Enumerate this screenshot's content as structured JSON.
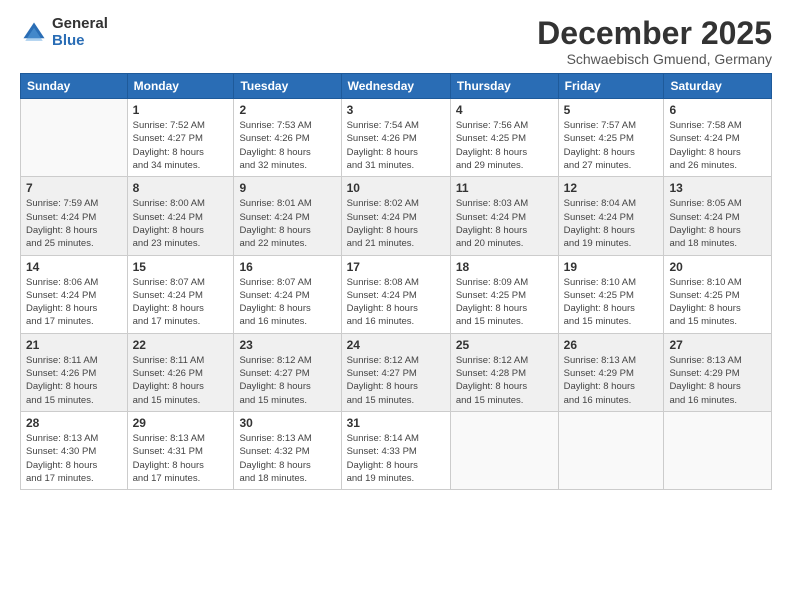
{
  "logo": {
    "general": "General",
    "blue": "Blue"
  },
  "header": {
    "month": "December 2025",
    "location": "Schwaebisch Gmuend, Germany"
  },
  "days_of_week": [
    "Sunday",
    "Monday",
    "Tuesday",
    "Wednesday",
    "Thursday",
    "Friday",
    "Saturday"
  ],
  "weeks": [
    [
      {
        "day": "",
        "info": ""
      },
      {
        "day": "1",
        "info": "Sunrise: 7:52 AM\nSunset: 4:27 PM\nDaylight: 8 hours\nand 34 minutes."
      },
      {
        "day": "2",
        "info": "Sunrise: 7:53 AM\nSunset: 4:26 PM\nDaylight: 8 hours\nand 32 minutes."
      },
      {
        "day": "3",
        "info": "Sunrise: 7:54 AM\nSunset: 4:26 PM\nDaylight: 8 hours\nand 31 minutes."
      },
      {
        "day": "4",
        "info": "Sunrise: 7:56 AM\nSunset: 4:25 PM\nDaylight: 8 hours\nand 29 minutes."
      },
      {
        "day": "5",
        "info": "Sunrise: 7:57 AM\nSunset: 4:25 PM\nDaylight: 8 hours\nand 27 minutes."
      },
      {
        "day": "6",
        "info": "Sunrise: 7:58 AM\nSunset: 4:24 PM\nDaylight: 8 hours\nand 26 minutes."
      }
    ],
    [
      {
        "day": "7",
        "info": "Sunrise: 7:59 AM\nSunset: 4:24 PM\nDaylight: 8 hours\nand 25 minutes."
      },
      {
        "day": "8",
        "info": "Sunrise: 8:00 AM\nSunset: 4:24 PM\nDaylight: 8 hours\nand 23 minutes."
      },
      {
        "day": "9",
        "info": "Sunrise: 8:01 AM\nSunset: 4:24 PM\nDaylight: 8 hours\nand 22 minutes."
      },
      {
        "day": "10",
        "info": "Sunrise: 8:02 AM\nSunset: 4:24 PM\nDaylight: 8 hours\nand 21 minutes."
      },
      {
        "day": "11",
        "info": "Sunrise: 8:03 AM\nSunset: 4:24 PM\nDaylight: 8 hours\nand 20 minutes."
      },
      {
        "day": "12",
        "info": "Sunrise: 8:04 AM\nSunset: 4:24 PM\nDaylight: 8 hours\nand 19 minutes."
      },
      {
        "day": "13",
        "info": "Sunrise: 8:05 AM\nSunset: 4:24 PM\nDaylight: 8 hours\nand 18 minutes."
      }
    ],
    [
      {
        "day": "14",
        "info": "Sunrise: 8:06 AM\nSunset: 4:24 PM\nDaylight: 8 hours\nand 17 minutes."
      },
      {
        "day": "15",
        "info": "Sunrise: 8:07 AM\nSunset: 4:24 PM\nDaylight: 8 hours\nand 17 minutes."
      },
      {
        "day": "16",
        "info": "Sunrise: 8:07 AM\nSunset: 4:24 PM\nDaylight: 8 hours\nand 16 minutes."
      },
      {
        "day": "17",
        "info": "Sunrise: 8:08 AM\nSunset: 4:24 PM\nDaylight: 8 hours\nand 16 minutes."
      },
      {
        "day": "18",
        "info": "Sunrise: 8:09 AM\nSunset: 4:25 PM\nDaylight: 8 hours\nand 15 minutes."
      },
      {
        "day": "19",
        "info": "Sunrise: 8:10 AM\nSunset: 4:25 PM\nDaylight: 8 hours\nand 15 minutes."
      },
      {
        "day": "20",
        "info": "Sunrise: 8:10 AM\nSunset: 4:25 PM\nDaylight: 8 hours\nand 15 minutes."
      }
    ],
    [
      {
        "day": "21",
        "info": "Sunrise: 8:11 AM\nSunset: 4:26 PM\nDaylight: 8 hours\nand 15 minutes."
      },
      {
        "day": "22",
        "info": "Sunrise: 8:11 AM\nSunset: 4:26 PM\nDaylight: 8 hours\nand 15 minutes."
      },
      {
        "day": "23",
        "info": "Sunrise: 8:12 AM\nSunset: 4:27 PM\nDaylight: 8 hours\nand 15 minutes."
      },
      {
        "day": "24",
        "info": "Sunrise: 8:12 AM\nSunset: 4:27 PM\nDaylight: 8 hours\nand 15 minutes."
      },
      {
        "day": "25",
        "info": "Sunrise: 8:12 AM\nSunset: 4:28 PM\nDaylight: 8 hours\nand 15 minutes."
      },
      {
        "day": "26",
        "info": "Sunrise: 8:13 AM\nSunset: 4:29 PM\nDaylight: 8 hours\nand 16 minutes."
      },
      {
        "day": "27",
        "info": "Sunrise: 8:13 AM\nSunset: 4:29 PM\nDaylight: 8 hours\nand 16 minutes."
      }
    ],
    [
      {
        "day": "28",
        "info": "Sunrise: 8:13 AM\nSunset: 4:30 PM\nDaylight: 8 hours\nand 17 minutes."
      },
      {
        "day": "29",
        "info": "Sunrise: 8:13 AM\nSunset: 4:31 PM\nDaylight: 8 hours\nand 17 minutes."
      },
      {
        "day": "30",
        "info": "Sunrise: 8:13 AM\nSunset: 4:32 PM\nDaylight: 8 hours\nand 18 minutes."
      },
      {
        "day": "31",
        "info": "Sunrise: 8:14 AM\nSunset: 4:33 PM\nDaylight: 8 hours\nand 19 minutes."
      },
      {
        "day": "",
        "info": ""
      },
      {
        "day": "",
        "info": ""
      },
      {
        "day": "",
        "info": ""
      }
    ]
  ]
}
